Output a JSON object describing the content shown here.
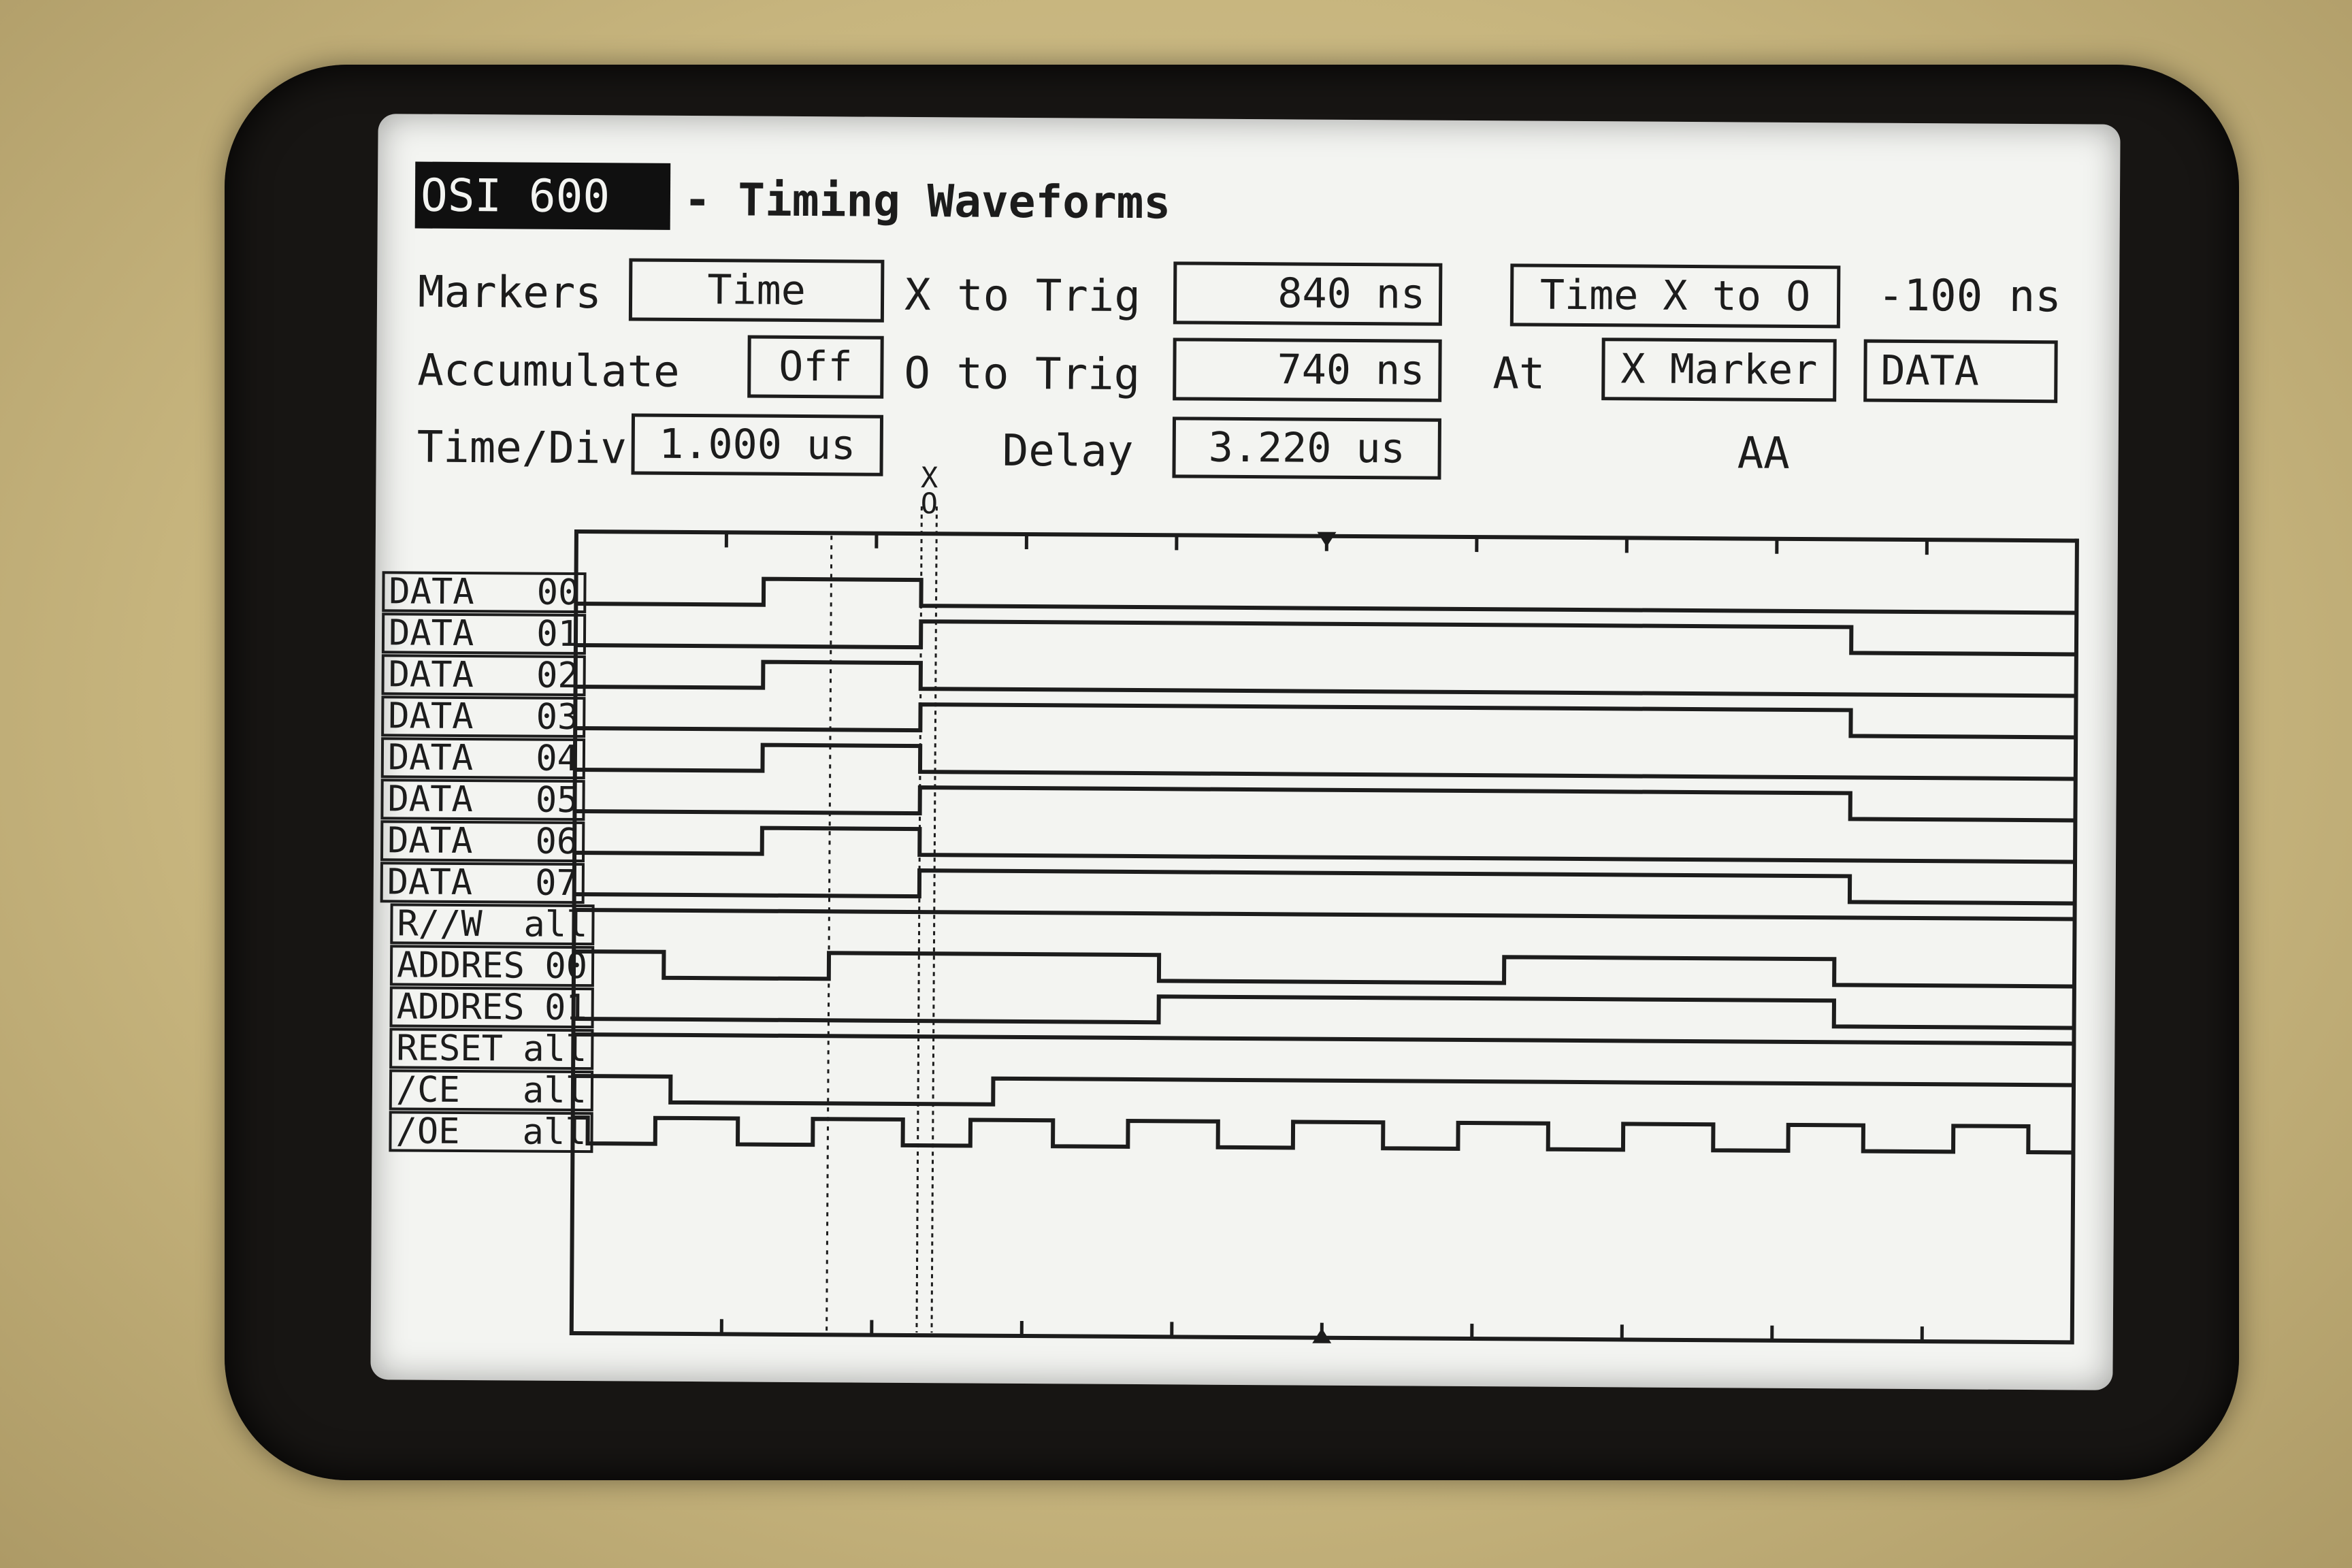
{
  "header": {
    "instrument": "OSI 600",
    "title": "- Timing Waveforms"
  },
  "controls": {
    "markers_label": "Markers",
    "markers_value": "Time",
    "x_to_trig_label": "X to Trig",
    "x_to_trig_value": "840 ns",
    "time_x_to_o_label": "Time X to O",
    "time_x_to_o_value": "-100 ns",
    "accumulate_label": "Accumulate",
    "accumulate_value": "Off",
    "o_to_trig_label": "O to Trig",
    "o_to_trig_value": "740 ns",
    "at_label": "At",
    "at_value": "X Marker",
    "at_channel": "DATA",
    "time_div_label": "Time/Div",
    "time_div_value": "1.000 us",
    "delay_label": "Delay",
    "delay_value": "3.220 us",
    "pattern_value": "AA"
  },
  "markers": {
    "x_label": "X",
    "o_label": "O"
  },
  "chart_data": {
    "type": "timing",
    "x_unit": "us",
    "time_per_div": 1.0,
    "divisions": 10,
    "x_marker": 2.4,
    "o_marker": 2.3,
    "cursor": 1.7,
    "trigger_at": 5.0,
    "channels": [
      {
        "name": "DATA",
        "id": "00",
        "initial": 0,
        "edges": [
          1.25,
          2.3
        ]
      },
      {
        "name": "DATA",
        "id": "01",
        "initial": 0,
        "edges": [
          2.3,
          8.5
        ]
      },
      {
        "name": "DATA",
        "id": "02",
        "initial": 0,
        "edges": [
          1.25,
          2.3
        ]
      },
      {
        "name": "DATA",
        "id": "03",
        "initial": 0,
        "edges": [
          2.3,
          8.5
        ]
      },
      {
        "name": "DATA",
        "id": "04",
        "initial": 0,
        "edges": [
          1.25,
          2.3
        ]
      },
      {
        "name": "DATA",
        "id": "05",
        "initial": 0,
        "edges": [
          2.3,
          8.5
        ]
      },
      {
        "name": "DATA",
        "id": "06",
        "initial": 0,
        "edges": [
          1.25,
          2.3
        ]
      },
      {
        "name": "DATA",
        "id": "07",
        "initial": 0,
        "edges": [
          2.3,
          8.5
        ]
      },
      {
        "name": "R//W",
        "id": "all",
        "initial": 1,
        "edges": []
      },
      {
        "name": "ADDRES",
        "id": "00",
        "initial": 1,
        "edges": [
          0.6,
          1.7,
          3.9,
          6.2,
          8.4
        ]
      },
      {
        "name": "ADDRES",
        "id": "01",
        "initial": 0,
        "edges": [
          3.9,
          8.4
        ]
      },
      {
        "name": "RESET",
        "id": "all",
        "initial": 1,
        "edges": []
      },
      {
        "name": "/CE",
        "id": "all",
        "initial": 1,
        "edges": [
          0.65,
          2.8
        ]
      },
      {
        "name": "/OE",
        "id": "all",
        "initial": 1,
        "edges": [
          0.1,
          0.55,
          1.1,
          1.6,
          2.2,
          2.65,
          3.2,
          3.7,
          4.3,
          4.8,
          5.4,
          5.9,
          6.5,
          7.0,
          7.6,
          8.1,
          8.6,
          9.2,
          9.7
        ]
      }
    ]
  }
}
